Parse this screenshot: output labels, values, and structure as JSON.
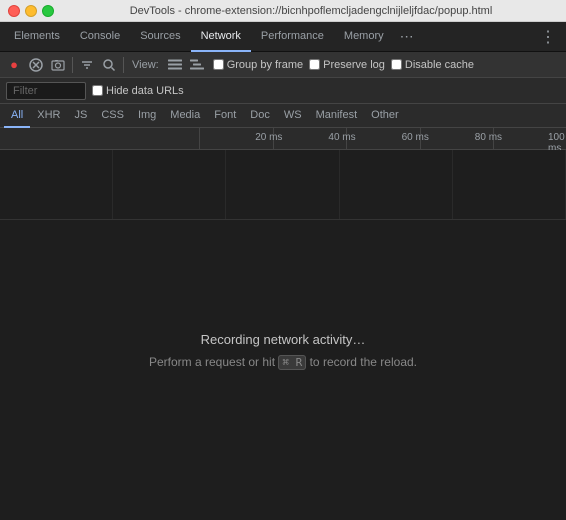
{
  "titlebar": {
    "title": "DevTools - chrome-extension://bicnhpoflemcljadengclnijleljfdac/popup.html"
  },
  "tabs": [
    {
      "id": "elements",
      "label": "Elements",
      "active": false
    },
    {
      "id": "console",
      "label": "Console",
      "active": false
    },
    {
      "id": "sources",
      "label": "Sources",
      "active": false
    },
    {
      "id": "network",
      "label": "Network",
      "active": true
    },
    {
      "id": "performance",
      "label": "Performance",
      "active": false
    },
    {
      "id": "memory",
      "label": "Memory",
      "active": false
    }
  ],
  "toolbar": {
    "view_label": "View:",
    "group_by_frame_label": "Group by frame",
    "preserve_log_label": "Preserve log",
    "disable_cache_label": "Disable cache"
  },
  "filter": {
    "placeholder": "Filter",
    "hide_data_urls_label": "Hide data URLs"
  },
  "type_tabs": [
    {
      "id": "all",
      "label": "All",
      "active": true
    },
    {
      "id": "xhr",
      "label": "XHR",
      "active": false
    },
    {
      "id": "js",
      "label": "JS",
      "active": false
    },
    {
      "id": "css",
      "label": "CSS",
      "active": false
    },
    {
      "id": "img",
      "label": "Img",
      "active": false
    },
    {
      "id": "media",
      "label": "Media",
      "active": false
    },
    {
      "id": "font",
      "label": "Font",
      "active": false
    },
    {
      "id": "doc",
      "label": "Doc",
      "active": false
    },
    {
      "id": "ws",
      "label": "WS",
      "active": false
    },
    {
      "id": "manifest",
      "label": "Manifest",
      "active": false
    },
    {
      "id": "other",
      "label": "Other",
      "active": false
    }
  ],
  "timeline": {
    "ticks": [
      "20 ms",
      "40 ms",
      "60 ms",
      "80 ms",
      "100 ms"
    ]
  },
  "empty_state": {
    "main_text": "Recording network activity…",
    "sub_text_before": "Perform a request or hit ",
    "shortcut": "⌘ R",
    "sub_text_after": " to record the reload."
  },
  "more_tabs_icon": "⋯",
  "menu_icon": "⋮",
  "record_icon": "●",
  "clear_icon": "✕",
  "camera_icon": "📷",
  "filter_icon": "▼",
  "search_icon": "🔍"
}
